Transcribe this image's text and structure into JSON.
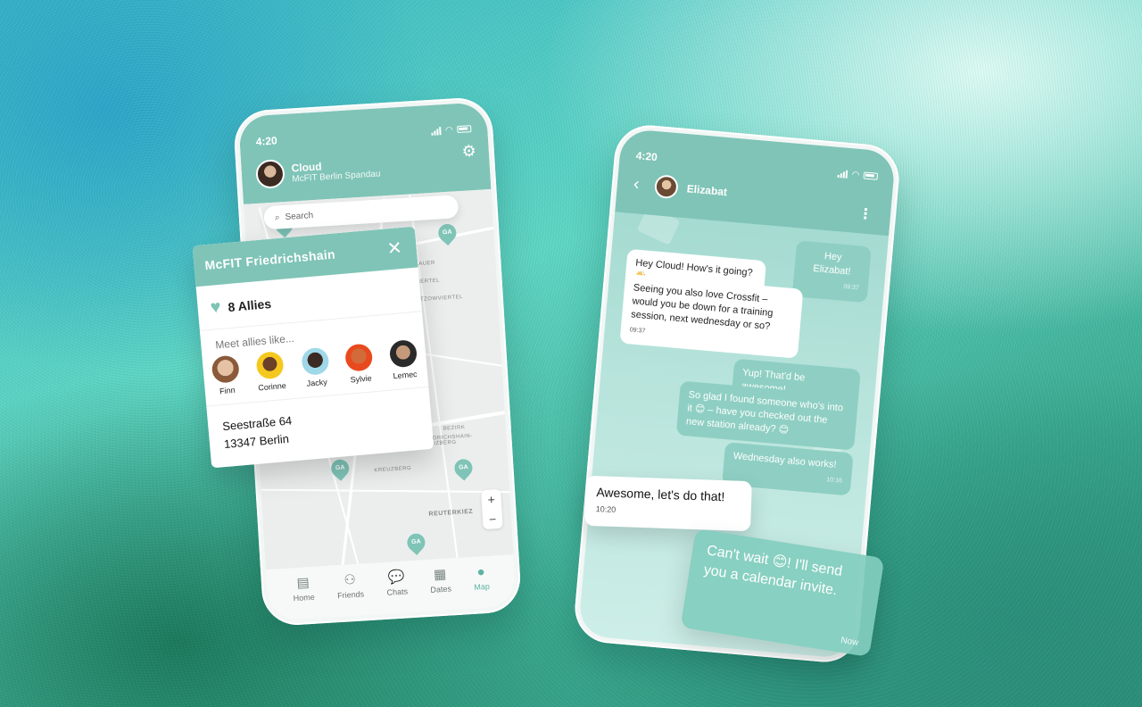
{
  "left_phone": {
    "status_time": "4:20",
    "user": {
      "name": "Cloud",
      "gym": "McFIT Berlin Spandau"
    },
    "search_placeholder": "Search",
    "map_labels": [
      "VIERTEL",
      "ÖTZOWVIERTEL",
      "LAUER",
      "BEZIRK",
      "FRIEDRICHSHAIN-KREUZBERG",
      "KREUZBERG",
      "REUTERKIEZ"
    ],
    "pins_text": "GA",
    "zoom_in": "+",
    "zoom_out": "−",
    "tabs": [
      {
        "label": "Home",
        "icon": "home-icon"
      },
      {
        "label": "Friends",
        "icon": "person-icon"
      },
      {
        "label": "Chats",
        "icon": "chat-bubble-icon"
      },
      {
        "label": "Dates",
        "icon": "calendar-icon"
      },
      {
        "label": "Map",
        "icon": "map-pin-icon"
      }
    ],
    "active_tab": "Map"
  },
  "gym_card": {
    "title": "McFIT Friedrichshain",
    "close": "✕",
    "allies": "8 Allies",
    "meet": "Meet allies like...",
    "people": [
      "Finn",
      "Corinne",
      "Jacky",
      "Sylvie",
      "Lemec"
    ],
    "address_line1": "Seestraße 64",
    "address_line2": "13347 Berlin"
  },
  "right_phone": {
    "status_time": "4:20",
    "contact": "Elizabat",
    "messages": [
      {
        "dir": "out",
        "text": "Hey Elizabat!",
        "time": "09:37"
      },
      {
        "dir": "in",
        "text": "Hey Cloud! How's it going? 👋",
        "time": ""
      },
      {
        "dir": "in",
        "text": "Seeing you also love Crossfit – would you be down for a training session, next wednesday or so?",
        "time": "09:37"
      },
      {
        "dir": "out",
        "text": "Yup! That'd be awesome!",
        "time": ""
      },
      {
        "dir": "out",
        "text": "So glad I found someone who's into it 😊 – have you checked out the new station already? 😊",
        "time": ""
      },
      {
        "dir": "out",
        "text": "Wednesday also works!",
        "time": "10:16"
      }
    ]
  },
  "floating": {
    "incoming": {
      "text": "Awesome, let's do that!",
      "time": "10:20"
    },
    "outgoing": {
      "text": "Can't wait 😊! I'll send you a calendar invite.",
      "time": "Now"
    }
  },
  "colors": {
    "accent": "#7fc4b7",
    "bubble_out": "#8fcfc3"
  }
}
